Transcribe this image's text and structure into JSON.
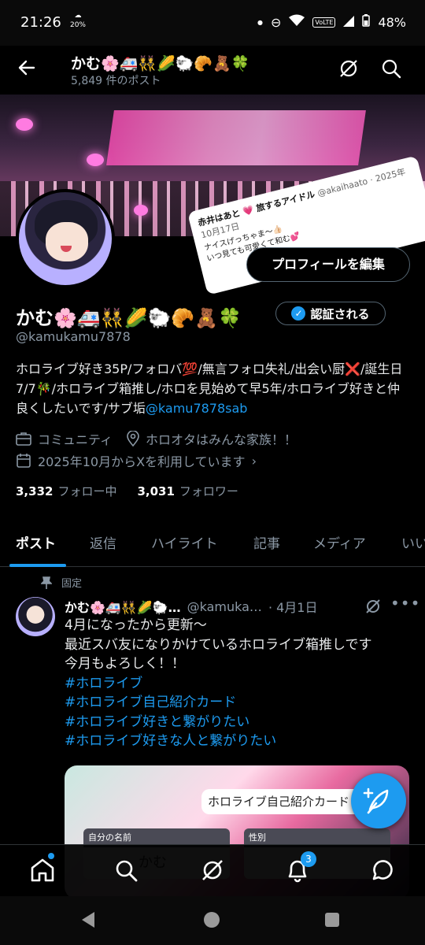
{
  "status_bar": {
    "time": "21:26",
    "weather_pct": "20%",
    "volte": "VoLTE",
    "battery": "48%"
  },
  "header": {
    "name": "かむ🌸🚑👯🌽🐑🥐🧸🍀",
    "post_count": "5,849 件のポスト"
  },
  "banner": {
    "embed_name": "赤井はあと 💗 旅するアイドル",
    "embed_handle": "@akaihaato · 2025年10月17日",
    "embed_text_1": "ナイスげっちゃま〜👍🏻",
    "embed_text_2": "いつ見ても可愛くて和む💕"
  },
  "profile": {
    "edit_button": "プロフィールを編集",
    "name": "かむ🌸🚑👯🌽🐑🥐🧸🍀",
    "verify_button": "認証される",
    "handle": "@kamukamu7878",
    "bio_text": "ホロライブ好き35P/フォロバ💯/無言フォロ失礼/出会い厨❌/誕生日7/7🎋/ホロライブ箱推し/ホロを見始めて早5年/ホロライブ好きと仲良くしたいです/サブ垢",
    "bio_link": "@kamu7878sab",
    "category": "コミュニティ",
    "location": "ホロオタはみんな家族！！",
    "joined": "2025年10月からXを利用しています",
    "following_count": "3,332",
    "following_label": "フォロー中",
    "followers_count": "3,031",
    "followers_label": "フォロワー"
  },
  "tabs": [
    {
      "label": "ポスト"
    },
    {
      "label": "返信"
    },
    {
      "label": "ハイライト"
    },
    {
      "label": "記事"
    },
    {
      "label": "メディア"
    },
    {
      "label": "いい"
    }
  ],
  "tweet": {
    "pinned_label": "固定",
    "name": "かむ🌸🚑👯🌽🐑…",
    "handle": "@kamuka…",
    "date": "· 4月1日",
    "line1": "4月になったから更新〜",
    "line2": "最近スバ友になりかけているホロライブ箱推しです",
    "line3": "今月もよろしく！！",
    "tags": [
      "#ホロライブ",
      "#ホロライブ自己紹介カード",
      "#ホロライブ好きと繋がりたい",
      "#ホロライブ好きな人と繋がりたい"
    ],
    "media_title": "ホロライブ自己紹介カード",
    "media_field1": "自分の名前",
    "media_field2": "性別",
    "media_value1": "かむ"
  },
  "bottom_nav": {
    "notification_badge": "3"
  },
  "colors": {
    "accent": "#1d9bf0",
    "background": "#000000",
    "secondary_text": "#8b98a5"
  }
}
